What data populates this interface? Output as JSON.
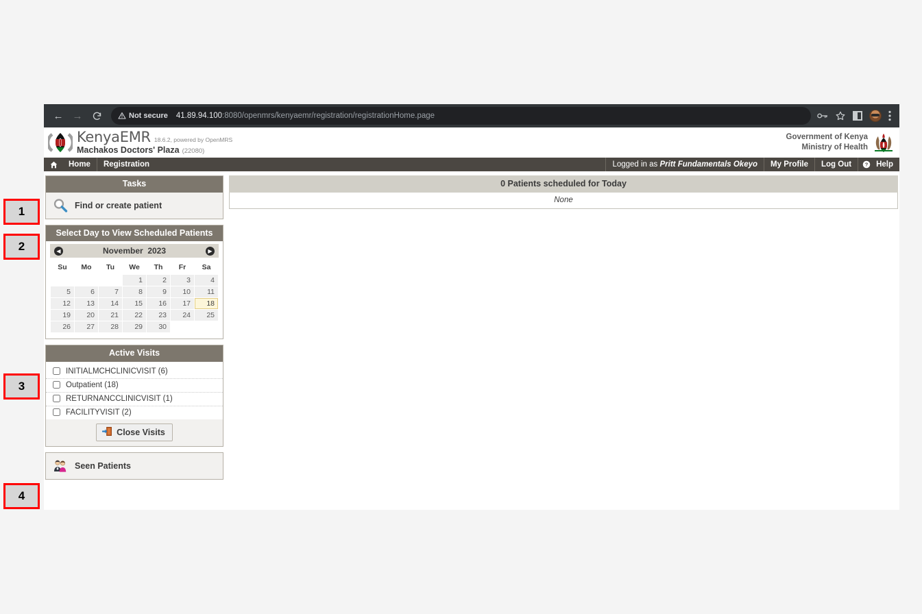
{
  "browser": {
    "back_icon": "back-arrow-icon",
    "forward_icon": "forward-arrow-icon",
    "reload_icon": "reload-icon",
    "security_label": "Not secure",
    "url_host": "41.89.94.100",
    "url_rest": ":8080/openmrs/kenyaemr/registration/registrationHome.page",
    "password_icon": "key-icon",
    "bookmark_icon": "star-icon",
    "sidepanel_icon": "side-panel-icon",
    "profile_icon": "profile-avatar-icon",
    "menu_icon": "three-dot-menu-icon"
  },
  "header": {
    "app_name": "KenyaEMR",
    "version": "18.6.2, powered by OpenMRS",
    "facility": "Machakos Doctors' Plaza",
    "facility_code": "(22080)",
    "gov_line1": "Government of Kenya",
    "gov_line2": "Ministry of Health",
    "logo_icon": "kenyaemr-shield-logo",
    "coat_icon": "kenya-coat-of-arms-icon"
  },
  "nav": {
    "home_icon": "home-icon",
    "home": "Home",
    "registration": "Registration",
    "logged_in_prefix": "Logged in as",
    "user_name": "Pritt Fundamentals Okeyo",
    "my_profile": "My Profile",
    "log_out": "Log Out",
    "help_icon": "question-mark-icon",
    "help": "Help"
  },
  "tasks": {
    "title": "Tasks",
    "find_or_create": "Find or create patient",
    "search_icon": "magnifying-glass-icon"
  },
  "calendar": {
    "title": "Select Day to View Scheduled Patients",
    "month": "November",
    "year": "2023",
    "prev_icon": "prev-month-arrow-icon",
    "next_icon": "next-month-arrow-icon",
    "weekdays": [
      "Su",
      "Mo",
      "Tu",
      "We",
      "Th",
      "Fr",
      "Sa"
    ],
    "lead_blanks": 3,
    "days": [
      1,
      2,
      3,
      4,
      5,
      6,
      7,
      8,
      9,
      10,
      11,
      12,
      13,
      14,
      15,
      16,
      17,
      18,
      19,
      20,
      21,
      22,
      23,
      24,
      25,
      26,
      27,
      28,
      29,
      30
    ],
    "today": 18
  },
  "active_visits": {
    "title": "Active Visits",
    "items": [
      {
        "label": "INITIALMCHCLINICVISIT (6)",
        "checked": false
      },
      {
        "label": "Outpatient (18)",
        "checked": false
      },
      {
        "label": "RETURNANCCLINICVISIT (1)",
        "checked": false
      },
      {
        "label": "FACILITYVISIT (2)",
        "checked": false
      }
    ],
    "close_button": "Close Visits",
    "close_icon": "exit-door-icon"
  },
  "seen_patients": {
    "label": "Seen Patients",
    "icon": "two-people-icon"
  },
  "content": {
    "scheduled_header": "0 Patients scheduled for Today",
    "empty_text": "None"
  },
  "annotations": [
    {
      "number": "1"
    },
    {
      "number": "2"
    },
    {
      "number": "3"
    },
    {
      "number": "4"
    }
  ]
}
